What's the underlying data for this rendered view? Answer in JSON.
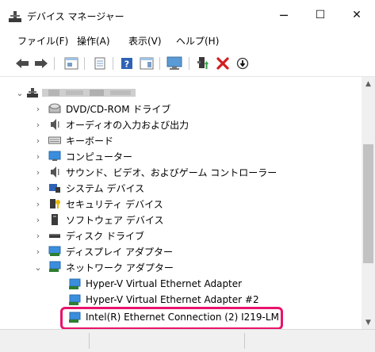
{
  "window": {
    "title": "デバイス マネージャー",
    "minimize_glyph": "─",
    "maximize_glyph": "☐",
    "close_glyph": "✕"
  },
  "menu": [
    "ファイル(F)",
    "操作(A)",
    "表示(V)",
    "ヘルプ(H)"
  ],
  "toolbar": {
    "icons": [
      "back-icon",
      "forward-icon",
      "properties-view-icon",
      "device-list-icon",
      "help-icon",
      "view-icon",
      "monitor-icon",
      "update-driver-icon",
      "uninstall-icon",
      "disable-icon"
    ]
  },
  "tree": {
    "root_label": "",
    "categories": [
      {
        "label": "DVD/CD-ROM ドライブ",
        "icon": "dvd-icon"
      },
      {
        "label": "オーディオの入力および出力",
        "icon": "speaker-icon"
      },
      {
        "label": "キーボード",
        "icon": "keyboard-icon"
      },
      {
        "label": "コンピューター",
        "icon": "computer-icon"
      },
      {
        "label": "サウンド、ビデオ、およびゲーム コントローラー",
        "icon": "speaker-icon"
      },
      {
        "label": "システム デバイス",
        "icon": "system-device-icon"
      },
      {
        "label": "セキュリティ デバイス",
        "icon": "security-icon"
      },
      {
        "label": "ソフトウェア デバイス",
        "icon": "software-device-icon"
      },
      {
        "label": "ディスク ドライブ",
        "icon": "disk-drive-icon"
      },
      {
        "label": "ディスプレイ アダプター",
        "icon": "display-adapter-icon"
      },
      {
        "label": "ネットワーク アダプター",
        "icon": "network-adapter-icon"
      }
    ],
    "network_children": [
      "Hyper-V Virtual Ethernet Adapter",
      "Hyper-V Virtual Ethernet Adapter #2",
      "Intel(R) Ethernet Connection (2) I219-LM"
    ],
    "collapsed_glyph": "›",
    "expanded_glyph": "⌄"
  },
  "scrollbar": {
    "up_glyph": "▲",
    "down_glyph": "▼"
  },
  "colors": {
    "highlight": "#e8146a",
    "selection": "#cce8ff"
  }
}
